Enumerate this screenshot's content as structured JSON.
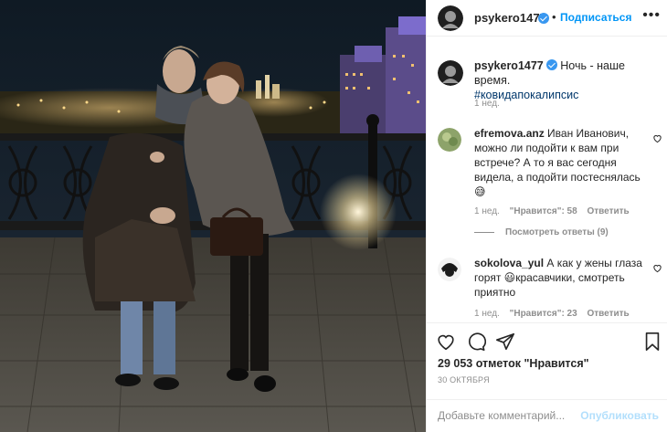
{
  "post": {
    "username": "psykero1477",
    "follow_label": "Подписаться",
    "more_label": "•••",
    "header_dot": "•",
    "caption_text": "Ночь - наше время.",
    "caption_hashtag": "#ковидапокалипсис",
    "caption_time": "1 нед.",
    "likes_text": "29 053 отметок \"Нравится\"",
    "date": "30 ОКТЯБРЯ"
  },
  "comments": [
    {
      "username": "efremova.anz",
      "text": "Иван Иванович, можно ли подойти к вам при встрече? А то я вас сегодня видела, а подойти постеснялась",
      "emoji": "😅",
      "time": "1 нед.",
      "likes": "\"Нравится\": 58",
      "reply_label": "Ответить"
    },
    {
      "username": "sokolova_yul",
      "text": "А как у жены глаза горят",
      "emoji": "😃",
      "text_after": "красавчики, смотреть приятно",
      "time": "1 нед.",
      "likes": "\"Нравится\": 23",
      "reply_label": "Ответить"
    }
  ],
  "view_replies_label": "Посмотреть ответы (9)",
  "add_comment": {
    "placeholder": "Добавьте комментарий...",
    "publish_label": "Опубликовать"
  },
  "colors": {
    "accent": "#0095f6",
    "verified": "#3897f0",
    "muted": "#8e8e8e",
    "publish_disabled": "#b2dffc"
  },
  "icons": [
    "verified-badge-icon",
    "more-options-icon",
    "heart-icon",
    "comment-icon",
    "share-icon",
    "bookmark-icon"
  ]
}
